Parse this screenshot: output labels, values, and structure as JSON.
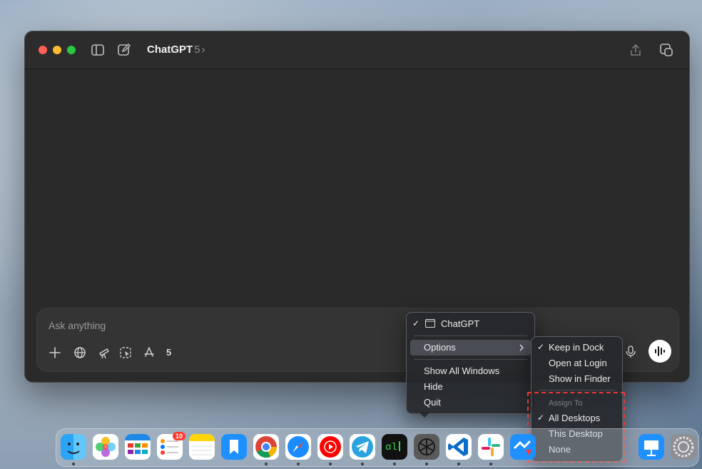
{
  "window": {
    "title": "ChatGPT",
    "model_version": "5",
    "chevron": "›"
  },
  "composer": {
    "placeholder": "Ask anything",
    "model_count": "5"
  },
  "context_menu": {
    "app_item": "ChatGPT",
    "options": "Options",
    "show_all_windows": "Show All Windows",
    "hide": "Hide",
    "quit": "Quit"
  },
  "options_submenu": {
    "keep_in_dock": "Keep in Dock",
    "open_at_login": "Open at Login",
    "show_in_finder": "Show in Finder",
    "assign_to_header": "Assign To",
    "all_desktops": "All Desktops",
    "this_desktop": "This Desktop",
    "none": "None",
    "check": "✓"
  },
  "dock": {
    "reminders_badge": "10",
    "apps": [
      "Finder",
      "Photos",
      "Calendar",
      "Reminders",
      "Notes",
      "Bookmarks",
      "Chrome",
      "Safari",
      "YouTube Music",
      "Telegram",
      "Terminal",
      "ChatGPT",
      "VS Code",
      "Slack",
      "Mail",
      "Keynote",
      "System Settings"
    ]
  },
  "colors": {
    "accent_red": "#e53935",
    "window_bg": "#2a2a2a",
    "composer_bg": "#343434"
  }
}
